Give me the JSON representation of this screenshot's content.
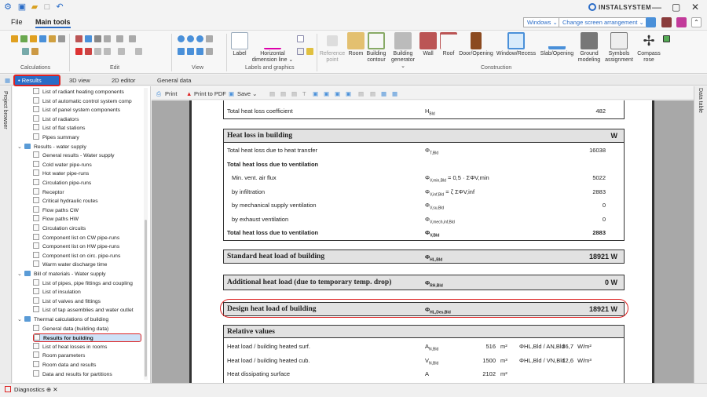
{
  "app": {
    "brand": "INSTALSYSTEM"
  },
  "menu": {
    "file": "File",
    "main_tools": "Main tools"
  },
  "topbar": {
    "windows": "Windows ⌄",
    "arrangement": "Change screen arrangement ⌄"
  },
  "ribbon": {
    "groups": [
      "Calculations",
      "Edit",
      "View",
      "Labels and graphics",
      "Construction"
    ],
    "buttons": [
      "Label",
      "Horizontal dimension line ⌄",
      "Reference point",
      "Room",
      "Building contour",
      "Building generator ⌄",
      "Wall",
      "Roof",
      "Door/Opening",
      "Window/Recess",
      "Slab/Opening",
      "Ground modeling",
      "Symbols assignment",
      "Compass rose"
    ]
  },
  "doctabs": [
    "• Results",
    "3D view",
    "2D editor",
    "General data"
  ],
  "side": {
    "left": "Project browser",
    "right": "Data table"
  },
  "tree": [
    "List of radiant heating components",
    "List of automatic control system comp",
    "List of panel system components",
    "List of radiators",
    "List of flat stations",
    "Pipes summary",
    "Results - water supply",
    "General results - Water supply",
    "Cold water pipe-runs",
    "Hot water pipe-runs",
    "Circulation pipe-runs",
    "Receptor",
    "Critical hydraulic routes",
    "Flow paths CW",
    "Flow paths HW",
    "Circulation circuits",
    "Component list on CW pipe-runs",
    "Component list on HW pipe-runs",
    "Component list on circ. pipe-runs",
    "Warm water discharge time",
    "Bill of materials - Water supply",
    "List of pipes, pipe fittings and coupling",
    "List of insulation",
    "List of valves and fittings",
    "List of tap assemblies and water outlet",
    "Thermal calculations of building",
    "General data (building data)",
    "Results for building",
    "List of heat losses in rooms",
    "Room parameters",
    "Room data and results",
    "Data and results for partitions"
  ],
  "report_toolbar": {
    "print": "Print",
    "pdf": "Print to PDF",
    "save": "Save ⌄"
  },
  "report": {
    "row0": {
      "label": "Total heat loss coefficient",
      "sym": "H",
      "sub": "Bld",
      "val": "482"
    },
    "sec1": {
      "title": "Heat loss in building",
      "unit": "W"
    },
    "rows1": [
      {
        "label": "Total heat loss due to heat transfer",
        "sym": "Φ",
        "sub": "T,Bld",
        "val": "16038",
        "bold": false
      },
      {
        "label": "Total heat loss due to ventilation",
        "sym": "",
        "sub": "",
        "val": "",
        "bold": true
      },
      {
        "label": "Min. vent. air flux",
        "sym": "Φ",
        "sub": "V,min,Bld",
        "extra": " = 0,5 · ΣΦV,min",
        "val": "5022",
        "bold": false
      },
      {
        "label": "by infiltration",
        "sym": "Φ",
        "sub": "V,inf,Bld",
        "extra": " = ζ ΣΦV,inf",
        "val": "2883",
        "bold": false
      },
      {
        "label": "by mechanical supply ventilation",
        "sym": "Φ",
        "sub": "V,su,Bld",
        "val": "0",
        "bold": false
      },
      {
        "label": "by exhaust ventilation",
        "sym": "Φ",
        "sub": "V,mech,inf,Bld",
        "val": "0",
        "bold": false
      },
      {
        "label": "Total heat loss due to ventilation",
        "sym": "Φ",
        "sub": "V,Bld",
        "val": "2883",
        "bold": true
      }
    ],
    "standard": {
      "title": "Standard heat load of building",
      "sym": "Φ",
      "sub": "HL,Bld",
      "val": "18921  W"
    },
    "additional": {
      "title": "Additional heat load (due to temporary temp. drop)",
      "sym": "Φ",
      "sub": "RH,Bld",
      "val": "0  W"
    },
    "design": {
      "title": "Design heat load of building",
      "sym": "Φ",
      "sub": "HL,Des,Bld",
      "val": "18921  W"
    },
    "relative": {
      "title": "Relative values"
    },
    "rel_rows": [
      {
        "label": "Heat load / building heated surf.",
        "sym": "A",
        "sub": "N,Bld",
        "val": "516",
        "unit": "m²",
        "ratio": "ΦHL,Bld / AN,Bld",
        "rval": "36,7",
        "runit": "W/m²"
      },
      {
        "label": "Heat load / building heated cub.",
        "sym": "V",
        "sub": "N,Bld",
        "val": "1500",
        "unit": "m³",
        "ratio": "ΦHL,Bld / VN,Bld",
        "rval": "12,6",
        "runit": "W/m³"
      },
      {
        "label": "Heat dissipating surface",
        "sym": "A",
        "sub": "",
        "val": "2102",
        "unit": "m²",
        "ratio": "",
        "rval": "",
        "runit": ""
      }
    ]
  },
  "bottom": {
    "diagnostics": "Diagnostics ⊕ ✕"
  }
}
